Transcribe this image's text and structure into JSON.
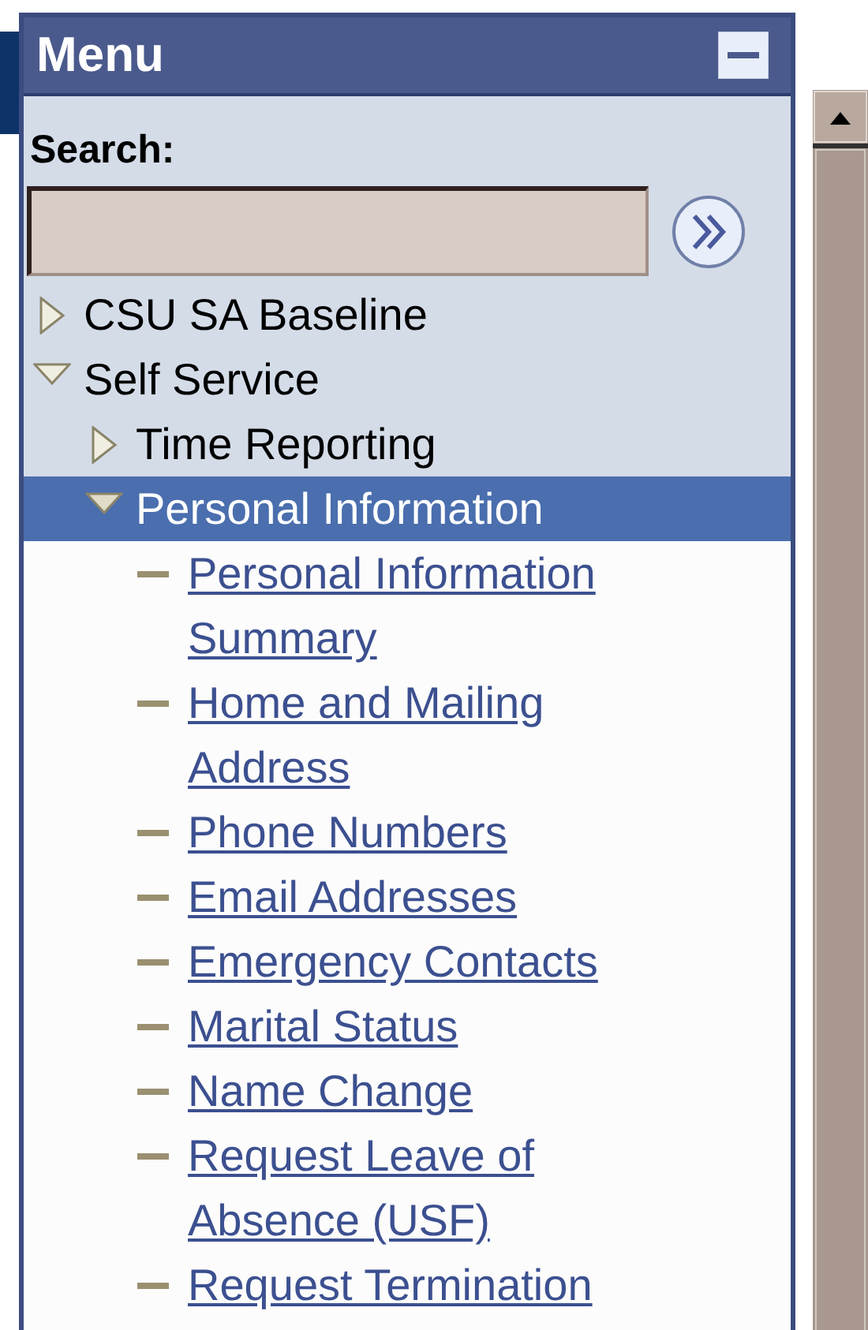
{
  "menu": {
    "title": "Menu",
    "search": {
      "label": "Search:"
    },
    "tree": [
      {
        "label": "CSU SA Baseline",
        "expanded": false,
        "selected": false
      },
      {
        "label": "Self Service",
        "expanded": true,
        "selected": false,
        "children": [
          {
            "label": "Time Reporting",
            "expanded": false,
            "selected": false
          },
          {
            "label": "Personal Information",
            "expanded": true,
            "selected": true,
            "children": [
              {
                "label": "Personal Information Summary",
                "kind": "link",
                "selected": false
              },
              {
                "label": "Home and Mailing Address",
                "kind": "link",
                "selected": false
              },
              {
                "label": "Phone Numbers",
                "kind": "link",
                "selected": false
              },
              {
                "label": "Email Addresses",
                "kind": "link",
                "selected": false
              },
              {
                "label": "Emergency Contacts",
                "kind": "link",
                "selected": false
              },
              {
                "label": "Marital Status",
                "kind": "link",
                "selected": false
              },
              {
                "label": "Name Change",
                "kind": "link",
                "selected": false
              },
              {
                "label": "Request Leave of Absence (USF)",
                "kind": "link",
                "selected": false
              },
              {
                "label": "Request Termination",
                "kind": "link",
                "selected": false
              }
            ]
          }
        ]
      }
    ]
  }
}
